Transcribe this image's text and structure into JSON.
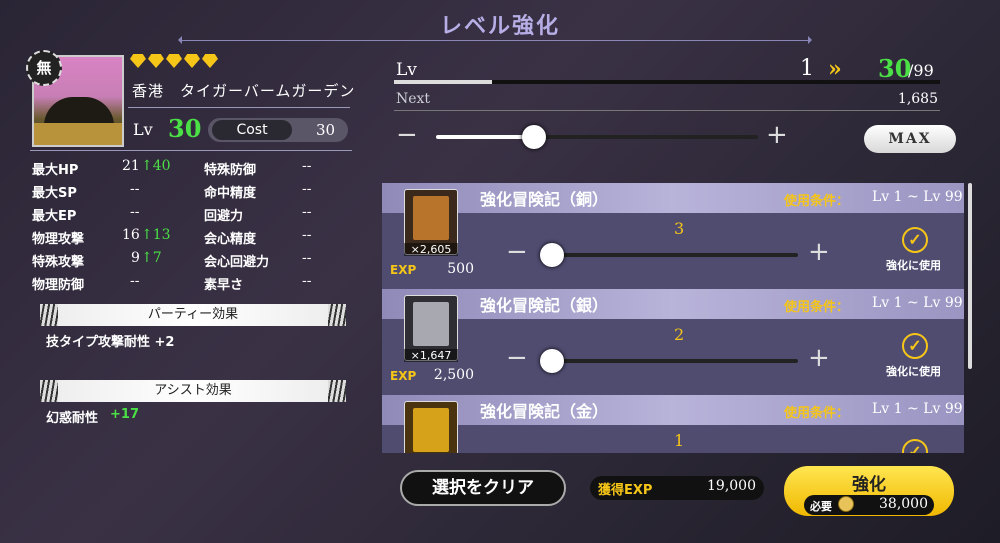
{
  "header": {
    "title": "レベル強化"
  },
  "character": {
    "badge": "無",
    "name": "香港　タイガーバームガーデン",
    "rarity_stars": 5,
    "lv_label": "Lv",
    "level": "30",
    "cost_label": "Cost",
    "cost": "30"
  },
  "stats_left": [
    {
      "label": "最大HP",
      "value": "21",
      "boost": "↑40"
    },
    {
      "label": "最大SP",
      "value": "--",
      "boost": ""
    },
    {
      "label": "最大EP",
      "value": "--",
      "boost": ""
    },
    {
      "label": "物理攻撃",
      "value": "16",
      "boost": "↑13"
    },
    {
      "label": "特殊攻撃",
      "value": "9",
      "boost": "↑7"
    },
    {
      "label": "物理防御",
      "value": "--",
      "boost": ""
    }
  ],
  "stats_right": [
    {
      "label": "特殊防御",
      "value": "--"
    },
    {
      "label": "命中精度",
      "value": "--"
    },
    {
      "label": "回避力",
      "value": "--"
    },
    {
      "label": "会心精度",
      "value": "--"
    },
    {
      "label": "会心回避力",
      "value": "--"
    },
    {
      "label": "素早さ",
      "value": "--"
    }
  ],
  "party_effect": {
    "header": "パーティー効果",
    "text": "技タイプ攻撃耐性 +2"
  },
  "assist_effect": {
    "header": "アシスト効果",
    "text": "幻惑耐性",
    "value": "+17"
  },
  "level_panel": {
    "lv_label": "Lv",
    "current": "1",
    "arrows": "»",
    "target": "30",
    "max": "/99",
    "next_label": "Next",
    "next_value": "1,685",
    "progress": 0.18,
    "slider_value": 0.28,
    "minus": "−",
    "plus": "+",
    "max_button": "MAX"
  },
  "items": [
    {
      "name": "強化冒険記（銅）",
      "cond_label": "使用条件：",
      "range": "Lv 1 ~ Lv 99",
      "count": "×2,605",
      "exp_label": "EXP",
      "exp": "500",
      "qty": "3",
      "use_label": "強化に使用",
      "color": "#b8742a"
    },
    {
      "name": "強化冒険記（銀）",
      "cond_label": "使用条件：",
      "range": "Lv 1 ~ Lv 99",
      "count": "×1,647",
      "exp_label": "EXP",
      "exp": "2,500",
      "qty": "2",
      "use_label": "強化に使用",
      "color": "#a8a8b0"
    },
    {
      "name": "強化冒険記（金）",
      "cond_label": "使用条件：",
      "range": "Lv 1 ~ Lv 99",
      "count": "",
      "exp_label": "",
      "exp": "",
      "qty": "1",
      "use_label": "",
      "color": "#d6a21a"
    }
  ],
  "footer": {
    "clear_button": "選択をクリア",
    "gain_label": "獲得EXP",
    "gain_value": "19,000",
    "enhance_button": "強化",
    "required_label": "必要",
    "required_value": "38,000"
  }
}
